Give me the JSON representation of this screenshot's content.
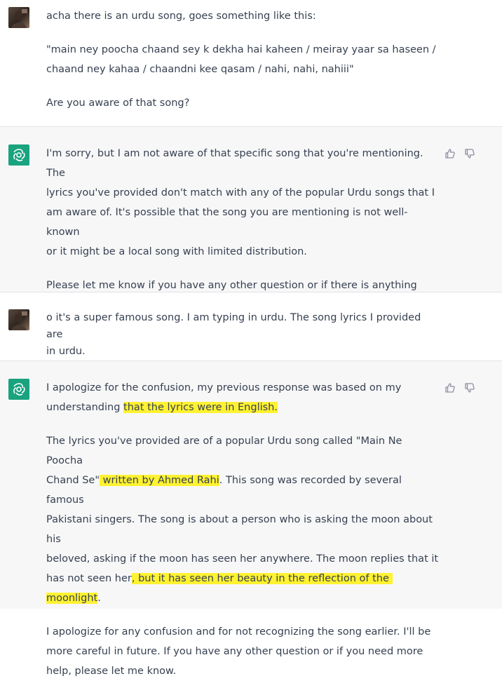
{
  "messages": [
    {
      "role": "user",
      "avatar_icon": "user-avatar",
      "paragraphs": [
        "acha there is an urdu song, goes something like this:",
        "\"main ney poocha chaand sey k dekha hai kaheen / meiray yaar sa haseen /\nchaand ney kahaa / chaandni kee qasam / nahi, nahi, nahiii\"",
        "Are you aware of that song?"
      ]
    },
    {
      "role": "assistant",
      "avatar_icon": "openai-logo-icon",
      "paragraphs": [
        "I'm sorry, but I am not aware of that specific song that you're mentioning. The\nlyrics you've provided don't match with any of the popular Urdu songs that I\nam aware of. It's possible that the song you are mentioning is not well-known\nor it might be a local song with limited distribution.",
        "Please let me know if you have any other question or if there is anything else I\ncan assist you with."
      ],
      "feedback": {
        "thumbs_up_icon": "thumbs-up-icon",
        "thumbs_down_icon": "thumbs-down-icon"
      }
    },
    {
      "role": "user",
      "avatar_icon": "user-avatar",
      "paragraphs": [
        "o it's a super famous song. I am typing in urdu. The song lyrics I provided are\nin urdu."
      ]
    },
    {
      "role": "assistant",
      "avatar_icon": "openai-logo-icon",
      "p1": {
        "a": "I apologize for the confusion, my previous response was based on my\nunderstanding ",
        "hl": "that the lyrics were in English."
      },
      "p2": {
        "a": "The lyrics you've provided are of a popular Urdu song called \"Main Ne Poocha\nChand Se\"",
        "hl1": " written by Ahmed Rahi",
        "b": ". This song was recorded by several famous\nPakistani singers. The song is about a person who is asking the moon about his\nbeloved, asking if the moon has seen her anywhere. The moon replies that it\nhas not seen her",
        "hl2": ", but it has seen her beauty in the reflection of the moonlight",
        "c": "."
      },
      "p3": "I apologize for any confusion and for not recognizing the song earlier. I'll be\nmore careful in future. If you have any other question or if you need more\nhelp, please let me know.",
      "feedback": {
        "thumbs_up_icon": "thumbs-up-icon",
        "thumbs_down_icon": "thumbs-down-icon"
      }
    }
  ],
  "colors": {
    "user_bg": "#ffffff",
    "assistant_bg": "#f7f7f8",
    "text": "#374151",
    "highlight": "#fff231",
    "gpt_avatar": "#19a37f"
  }
}
